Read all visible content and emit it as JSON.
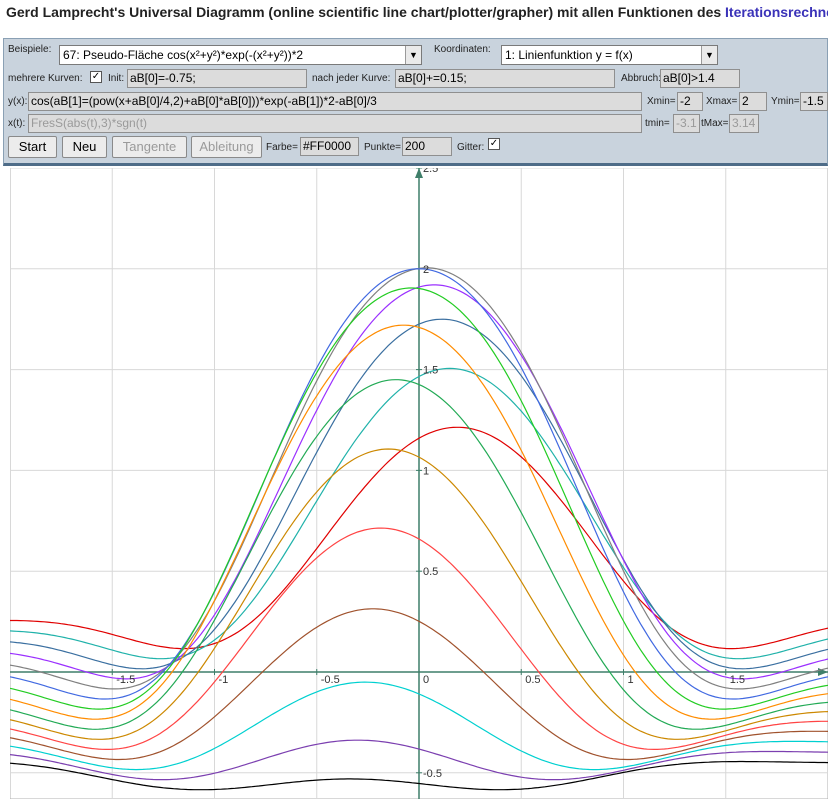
{
  "header": {
    "title_prefix": "Gerd Lamprecht's Universal Diagramm (online scientific line chart/plotter/grapher) mit allen Funktionen des",
    "link_text": "Iterationsrechners",
    "title_suffix": "!"
  },
  "controls": {
    "beispiele_label": "Beispiele:",
    "beispiele_value": "67: Pseudo-Fläche cos(x²+y²)*exp(-(x²+y²))*2",
    "koordinaten_label": "Koordinaten:",
    "koordinaten_value": "1: Linienfunktion y = f(x)",
    "mehrere_label": "mehrere Kurven:",
    "init_label": "Init:",
    "init_value": "aB[0]=-0.75;",
    "nach_label": "nach jeder Kurve:",
    "nach_value": "aB[0]+=0.15;",
    "abbruch_label": "Abbruch:",
    "abbruch_value": "aB[0]>1.4",
    "yx_label": "y(x):",
    "yx_value": "cos(aB[1]=(pow(x+aB[0]/4,2)+aB[0]*aB[0]))*exp(-aB[1])*2-aB[0]/3",
    "xmin_label": "Xmin=",
    "xmin_value": "-2",
    "xmax_label": "Xmax=",
    "xmax_value": "2",
    "ymin_label": "Ymin=",
    "ymin_value": "-1.5",
    "xt_label": "x(t):",
    "xt_value": "FresS(abs(t),3)*sgn(t)",
    "tmin_label": "tmin=",
    "tmin_value": "-3.1",
    "tmax_label": "tMax=",
    "tmax_value": "3.14",
    "start_button": "Start",
    "neu_button": "Neu",
    "tangente_button": "Tangente",
    "ableitung_button": "Ableitung",
    "farbe_label": "Farbe=",
    "farbe_value": "#FF0000",
    "punkte_label": "Punkte=",
    "punkte_value": "200",
    "gitter_label": "Gitter:",
    "checkmark": "✓"
  },
  "chart_data": {
    "type": "line",
    "function": "cos(aB[1]=(pow(x+aB[0]/4,2)+aB[0]*aB[0]))*exp(-aB[1])*2-aB[0]/3",
    "param_start": -0.75,
    "param_step": 0.15,
    "param_stop": 1.4,
    "visible_x_range": [
      -2,
      2
    ],
    "visible_y_range": [
      -0.63,
      2.5
    ],
    "x_ticks": [
      {
        "value": -1.5,
        "label": "-1.5"
      },
      {
        "value": -1,
        "label": "-1"
      },
      {
        "value": -0.5,
        "label": "-0.5"
      },
      {
        "value": 0,
        "label": "0"
      },
      {
        "value": 0.5,
        "label": "0.5"
      },
      {
        "value": 1,
        "label": "1"
      },
      {
        "value": 1.5,
        "label": "1.5"
      }
    ],
    "y_ticks": [
      {
        "value": 2.5,
        "label": "2.5"
      },
      {
        "value": 2,
        "label": "2"
      },
      {
        "value": 1.5,
        "label": "1.5"
      },
      {
        "value": 1,
        "label": "1"
      },
      {
        "value": 0.5,
        "label": "0.5"
      },
      {
        "value": -0.5,
        "label": "-0.5"
      }
    ],
    "series_colors": [
      "#e00000",
      "#20b2aa",
      "#3a6fa0",
      "#9b30ff",
      "#808080",
      "#4169e1",
      "#22cc22",
      "#ff8c00",
      "#22aa55",
      "#cc8800",
      "#ff4444",
      "#a0522d",
      "#00d0d0",
      "#7b3fb0",
      "#000000"
    ],
    "grid": true,
    "axis_color": "#3f7f6a",
    "grid_color": "#d8d8d8"
  }
}
